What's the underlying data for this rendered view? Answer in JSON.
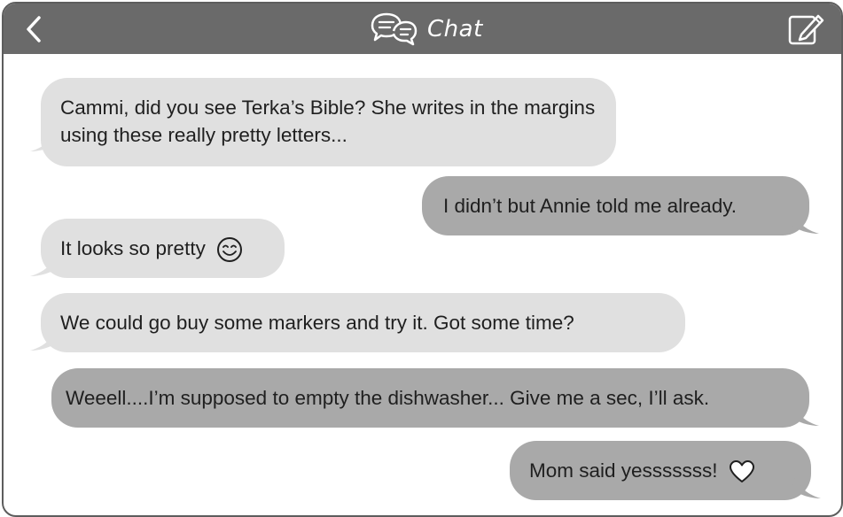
{
  "header": {
    "title": "Chat",
    "back_icon": "chevron-left-icon",
    "title_icon": "chat-bubbles-icon",
    "compose_icon": "compose-icon",
    "background": "#6a6a6a"
  },
  "messages": [
    {
      "side": "received",
      "text": "Cammi, did you see Terka’s Bible? She writes in the margins using these really pretty letters..."
    },
    {
      "side": "sent",
      "text": "I didn’t but Annie told me already."
    },
    {
      "side": "received",
      "text": "It looks so pretty",
      "emoji": "smiling-face-icon"
    },
    {
      "side": "received",
      "text": "We could go buy some markers and try it. Got some time?"
    },
    {
      "side": "sent",
      "text": "Weeell....I’m supposed to empty the dishwasher... Give me a sec, I’ll ask."
    },
    {
      "side": "sent",
      "text": "Mom said yesssssss!",
      "emoji": "heart-icon"
    }
  ],
  "colors": {
    "received_bubble": "#e0e0e0",
    "sent_bubble": "#a9a9a9",
    "frame_border": "#5d5d5d"
  }
}
